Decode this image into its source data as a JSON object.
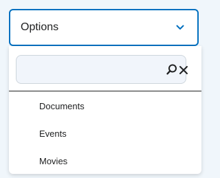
{
  "select": {
    "label": "Options"
  },
  "dropdown": {
    "search_placeholder": "",
    "options": [
      {
        "label": "Documents"
      },
      {
        "label": "Events"
      },
      {
        "label": "Movies"
      }
    ]
  },
  "icons": {
    "chevron": "chevron-down-icon",
    "search": "search-icon",
    "clear": "close-icon"
  },
  "colors": {
    "accent": "#006fbf",
    "text": "#202122",
    "search_bg": "#f1f5fb",
    "page_bg": "#f0f6fb"
  }
}
